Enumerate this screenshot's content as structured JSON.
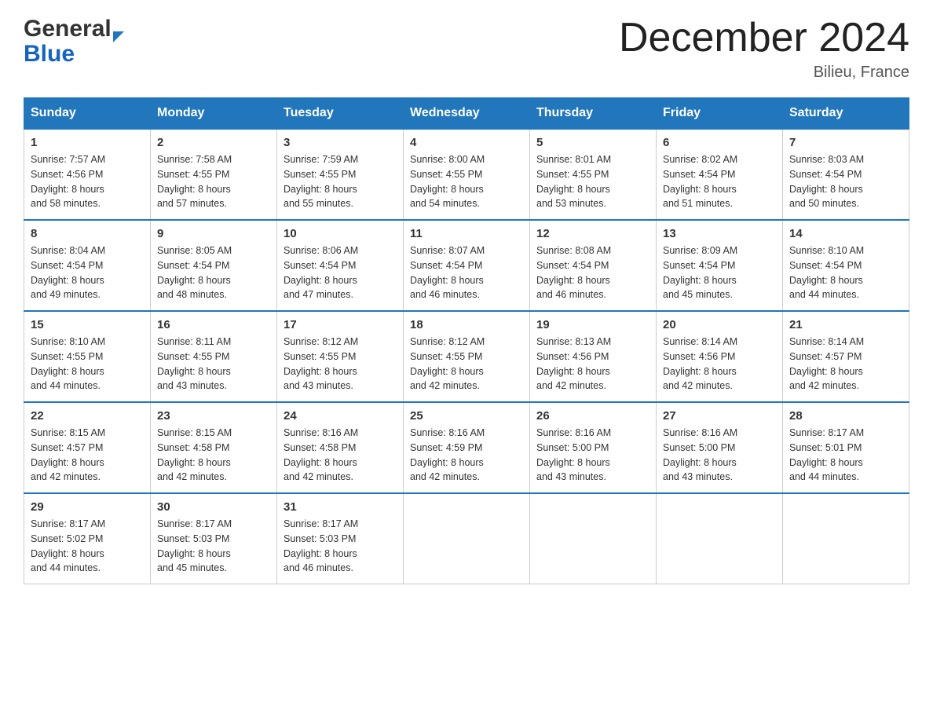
{
  "header": {
    "logo_general": "General",
    "logo_blue": "Blue",
    "month_title": "December 2024",
    "location": "Bilieu, France"
  },
  "weekdays": [
    "Sunday",
    "Monday",
    "Tuesday",
    "Wednesday",
    "Thursday",
    "Friday",
    "Saturday"
  ],
  "weeks": [
    [
      {
        "day": "1",
        "sunrise": "7:57 AM",
        "sunset": "4:56 PM",
        "daylight": "8 hours and 58 minutes."
      },
      {
        "day": "2",
        "sunrise": "7:58 AM",
        "sunset": "4:55 PM",
        "daylight": "8 hours and 57 minutes."
      },
      {
        "day": "3",
        "sunrise": "7:59 AM",
        "sunset": "4:55 PM",
        "daylight": "8 hours and 55 minutes."
      },
      {
        "day": "4",
        "sunrise": "8:00 AM",
        "sunset": "4:55 PM",
        "daylight": "8 hours and 54 minutes."
      },
      {
        "day": "5",
        "sunrise": "8:01 AM",
        "sunset": "4:55 PM",
        "daylight": "8 hours and 53 minutes."
      },
      {
        "day": "6",
        "sunrise": "8:02 AM",
        "sunset": "4:54 PM",
        "daylight": "8 hours and 51 minutes."
      },
      {
        "day": "7",
        "sunrise": "8:03 AM",
        "sunset": "4:54 PM",
        "daylight": "8 hours and 50 minutes."
      }
    ],
    [
      {
        "day": "8",
        "sunrise": "8:04 AM",
        "sunset": "4:54 PM",
        "daylight": "8 hours and 49 minutes."
      },
      {
        "day": "9",
        "sunrise": "8:05 AM",
        "sunset": "4:54 PM",
        "daylight": "8 hours and 48 minutes."
      },
      {
        "day": "10",
        "sunrise": "8:06 AM",
        "sunset": "4:54 PM",
        "daylight": "8 hours and 47 minutes."
      },
      {
        "day": "11",
        "sunrise": "8:07 AM",
        "sunset": "4:54 PM",
        "daylight": "8 hours and 46 minutes."
      },
      {
        "day": "12",
        "sunrise": "8:08 AM",
        "sunset": "4:54 PM",
        "daylight": "8 hours and 46 minutes."
      },
      {
        "day": "13",
        "sunrise": "8:09 AM",
        "sunset": "4:54 PM",
        "daylight": "8 hours and 45 minutes."
      },
      {
        "day": "14",
        "sunrise": "8:10 AM",
        "sunset": "4:54 PM",
        "daylight": "8 hours and 44 minutes."
      }
    ],
    [
      {
        "day": "15",
        "sunrise": "8:10 AM",
        "sunset": "4:55 PM",
        "daylight": "8 hours and 44 minutes."
      },
      {
        "day": "16",
        "sunrise": "8:11 AM",
        "sunset": "4:55 PM",
        "daylight": "8 hours and 43 minutes."
      },
      {
        "day": "17",
        "sunrise": "8:12 AM",
        "sunset": "4:55 PM",
        "daylight": "8 hours and 43 minutes."
      },
      {
        "day": "18",
        "sunrise": "8:12 AM",
        "sunset": "4:55 PM",
        "daylight": "8 hours and 42 minutes."
      },
      {
        "day": "19",
        "sunrise": "8:13 AM",
        "sunset": "4:56 PM",
        "daylight": "8 hours and 42 minutes."
      },
      {
        "day": "20",
        "sunrise": "8:14 AM",
        "sunset": "4:56 PM",
        "daylight": "8 hours and 42 minutes."
      },
      {
        "day": "21",
        "sunrise": "8:14 AM",
        "sunset": "4:57 PM",
        "daylight": "8 hours and 42 minutes."
      }
    ],
    [
      {
        "day": "22",
        "sunrise": "8:15 AM",
        "sunset": "4:57 PM",
        "daylight": "8 hours and 42 minutes."
      },
      {
        "day": "23",
        "sunrise": "8:15 AM",
        "sunset": "4:58 PM",
        "daylight": "8 hours and 42 minutes."
      },
      {
        "day": "24",
        "sunrise": "8:16 AM",
        "sunset": "4:58 PM",
        "daylight": "8 hours and 42 minutes."
      },
      {
        "day": "25",
        "sunrise": "8:16 AM",
        "sunset": "4:59 PM",
        "daylight": "8 hours and 42 minutes."
      },
      {
        "day": "26",
        "sunrise": "8:16 AM",
        "sunset": "5:00 PM",
        "daylight": "8 hours and 43 minutes."
      },
      {
        "day": "27",
        "sunrise": "8:16 AM",
        "sunset": "5:00 PM",
        "daylight": "8 hours and 43 minutes."
      },
      {
        "day": "28",
        "sunrise": "8:17 AM",
        "sunset": "5:01 PM",
        "daylight": "8 hours and 44 minutes."
      }
    ],
    [
      {
        "day": "29",
        "sunrise": "8:17 AM",
        "sunset": "5:02 PM",
        "daylight": "8 hours and 44 minutes."
      },
      {
        "day": "30",
        "sunrise": "8:17 AM",
        "sunset": "5:03 PM",
        "daylight": "8 hours and 45 minutes."
      },
      {
        "day": "31",
        "sunrise": "8:17 AM",
        "sunset": "5:03 PM",
        "daylight": "8 hours and 46 minutes."
      },
      null,
      null,
      null,
      null
    ]
  ],
  "labels": {
    "sunrise": "Sunrise:",
    "sunset": "Sunset:",
    "daylight": "Daylight:"
  }
}
